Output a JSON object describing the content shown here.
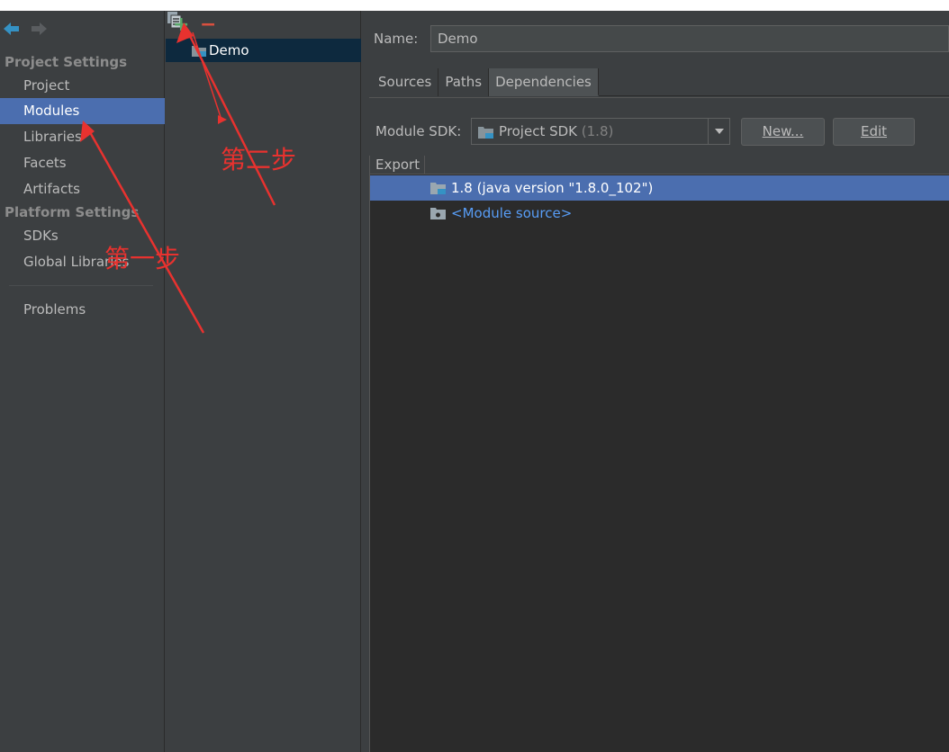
{
  "sidebar": {
    "project_settings_header": "Project Settings",
    "platform_settings_header": "Platform Settings",
    "items": [
      {
        "label": "Project"
      },
      {
        "label": "Modules"
      },
      {
        "label": "Libraries"
      },
      {
        "label": "Facets"
      },
      {
        "label": "Artifacts"
      },
      {
        "label": "SDKs"
      },
      {
        "label": "Global Libraries"
      },
      {
        "label": "Problems"
      }
    ],
    "selected_item": "Modules"
  },
  "module_panel": {
    "toolbar": {
      "add": "+",
      "remove": "−",
      "copy_icon": "copy-icon"
    },
    "modules": [
      {
        "name": "Demo"
      }
    ]
  },
  "detail": {
    "name_label": "Name:",
    "name_value": "Demo",
    "tabs": [
      {
        "label": "Sources"
      },
      {
        "label": "Paths"
      },
      {
        "label": "Dependencies"
      }
    ],
    "active_tab": "Dependencies",
    "module_sdk_label": "Module SDK:",
    "sdk_value": "Project SDK",
    "sdk_version": "(1.8)",
    "new_button": "New...",
    "edit_button": "Edit",
    "table": {
      "header_export": "Export",
      "rows": [
        {
          "label": "1.8 (java version \"1.8.0_102\")",
          "icon": "jdk-folder-icon"
        },
        {
          "label": "<Module source>",
          "icon": "module-source-icon"
        }
      ]
    }
  },
  "annotations": {
    "step_two": "第二步",
    "step_one": "第一步"
  },
  "colors": {
    "selection": "#4b6eaf",
    "add_green": "#59a869",
    "remove_red": "#d9503f",
    "annotation_red": "#e8322f",
    "link_blue": "#589df6"
  }
}
